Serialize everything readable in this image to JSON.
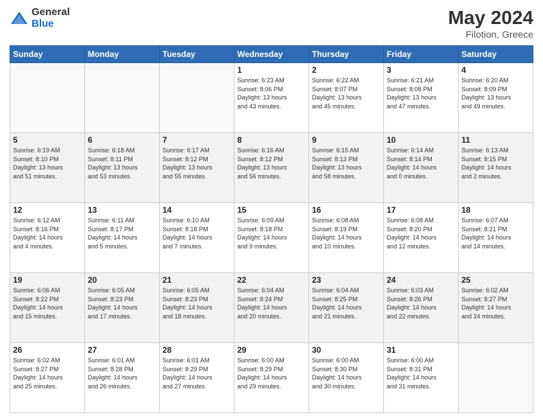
{
  "header": {
    "logo_general": "General",
    "logo_blue": "Blue",
    "month_year": "May 2024",
    "location": "Filotion, Greece"
  },
  "weekdays": [
    "Sunday",
    "Monday",
    "Tuesday",
    "Wednesday",
    "Thursday",
    "Friday",
    "Saturday"
  ],
  "weeks": [
    [
      {
        "day": "",
        "info": ""
      },
      {
        "day": "",
        "info": ""
      },
      {
        "day": "",
        "info": ""
      },
      {
        "day": "1",
        "info": "Sunrise: 6:23 AM\nSunset: 8:06 PM\nDaylight: 13 hours\nand 43 minutes."
      },
      {
        "day": "2",
        "info": "Sunrise: 6:22 AM\nSunset: 8:07 PM\nDaylight: 13 hours\nand 45 minutes."
      },
      {
        "day": "3",
        "info": "Sunrise: 6:21 AM\nSunset: 8:08 PM\nDaylight: 13 hours\nand 47 minutes."
      },
      {
        "day": "4",
        "info": "Sunrise: 6:20 AM\nSunset: 8:09 PM\nDaylight: 13 hours\nand 49 minutes."
      }
    ],
    [
      {
        "day": "5",
        "info": "Sunrise: 6:19 AM\nSunset: 8:10 PM\nDaylight: 13 hours\nand 51 minutes."
      },
      {
        "day": "6",
        "info": "Sunrise: 6:18 AM\nSunset: 8:11 PM\nDaylight: 13 hours\nand 53 minutes."
      },
      {
        "day": "7",
        "info": "Sunrise: 6:17 AM\nSunset: 8:12 PM\nDaylight: 13 hours\nand 55 minutes."
      },
      {
        "day": "8",
        "info": "Sunrise: 6:16 AM\nSunset: 8:12 PM\nDaylight: 13 hours\nand 56 minutes."
      },
      {
        "day": "9",
        "info": "Sunrise: 6:15 AM\nSunset: 8:13 PM\nDaylight: 13 hours\nand 58 minutes."
      },
      {
        "day": "10",
        "info": "Sunrise: 6:14 AM\nSunset: 8:14 PM\nDaylight: 14 hours\nand 0 minutes."
      },
      {
        "day": "11",
        "info": "Sunrise: 6:13 AM\nSunset: 8:15 PM\nDaylight: 14 hours\nand 2 minutes."
      }
    ],
    [
      {
        "day": "12",
        "info": "Sunrise: 6:12 AM\nSunset: 8:16 PM\nDaylight: 14 hours\nand 4 minutes."
      },
      {
        "day": "13",
        "info": "Sunrise: 6:11 AM\nSunset: 8:17 PM\nDaylight: 14 hours\nand 5 minutes."
      },
      {
        "day": "14",
        "info": "Sunrise: 6:10 AM\nSunset: 8:18 PM\nDaylight: 14 hours\nand 7 minutes."
      },
      {
        "day": "15",
        "info": "Sunrise: 6:09 AM\nSunset: 8:18 PM\nDaylight: 14 hours\nand 9 minutes."
      },
      {
        "day": "16",
        "info": "Sunrise: 6:08 AM\nSunset: 8:19 PM\nDaylight: 14 hours\nand 10 minutes."
      },
      {
        "day": "17",
        "info": "Sunrise: 6:08 AM\nSunset: 8:20 PM\nDaylight: 14 hours\nand 12 minutes."
      },
      {
        "day": "18",
        "info": "Sunrise: 6:07 AM\nSunset: 8:21 PM\nDaylight: 14 hours\nand 14 minutes."
      }
    ],
    [
      {
        "day": "19",
        "info": "Sunrise: 6:06 AM\nSunset: 8:22 PM\nDaylight: 14 hours\nand 15 minutes."
      },
      {
        "day": "20",
        "info": "Sunrise: 6:05 AM\nSunset: 8:23 PM\nDaylight: 14 hours\nand 17 minutes."
      },
      {
        "day": "21",
        "info": "Sunrise: 6:05 AM\nSunset: 8:23 PM\nDaylight: 14 hours\nand 18 minutes."
      },
      {
        "day": "22",
        "info": "Sunrise: 6:04 AM\nSunset: 8:24 PM\nDaylight: 14 hours\nand 20 minutes."
      },
      {
        "day": "23",
        "info": "Sunrise: 6:04 AM\nSunset: 8:25 PM\nDaylight: 14 hours\nand 21 minutes."
      },
      {
        "day": "24",
        "info": "Sunrise: 6:03 AM\nSunset: 8:26 PM\nDaylight: 14 hours\nand 22 minutes."
      },
      {
        "day": "25",
        "info": "Sunrise: 6:02 AM\nSunset: 8:27 PM\nDaylight: 14 hours\nand 24 minutes."
      }
    ],
    [
      {
        "day": "26",
        "info": "Sunrise: 6:02 AM\nSunset: 8:27 PM\nDaylight: 14 hours\nand 25 minutes."
      },
      {
        "day": "27",
        "info": "Sunrise: 6:01 AM\nSunset: 8:28 PM\nDaylight: 14 hours\nand 26 minutes."
      },
      {
        "day": "28",
        "info": "Sunrise: 6:01 AM\nSunset: 8:29 PM\nDaylight: 14 hours\nand 27 minutes."
      },
      {
        "day": "29",
        "info": "Sunrise: 6:00 AM\nSunset: 8:29 PM\nDaylight: 14 hours\nand 29 minutes."
      },
      {
        "day": "30",
        "info": "Sunrise: 6:00 AM\nSunset: 8:30 PM\nDaylight: 14 hours\nand 30 minutes."
      },
      {
        "day": "31",
        "info": "Sunrise: 6:00 AM\nSunset: 8:31 PM\nDaylight: 14 hours\nand 31 minutes."
      },
      {
        "day": "",
        "info": ""
      }
    ]
  ]
}
